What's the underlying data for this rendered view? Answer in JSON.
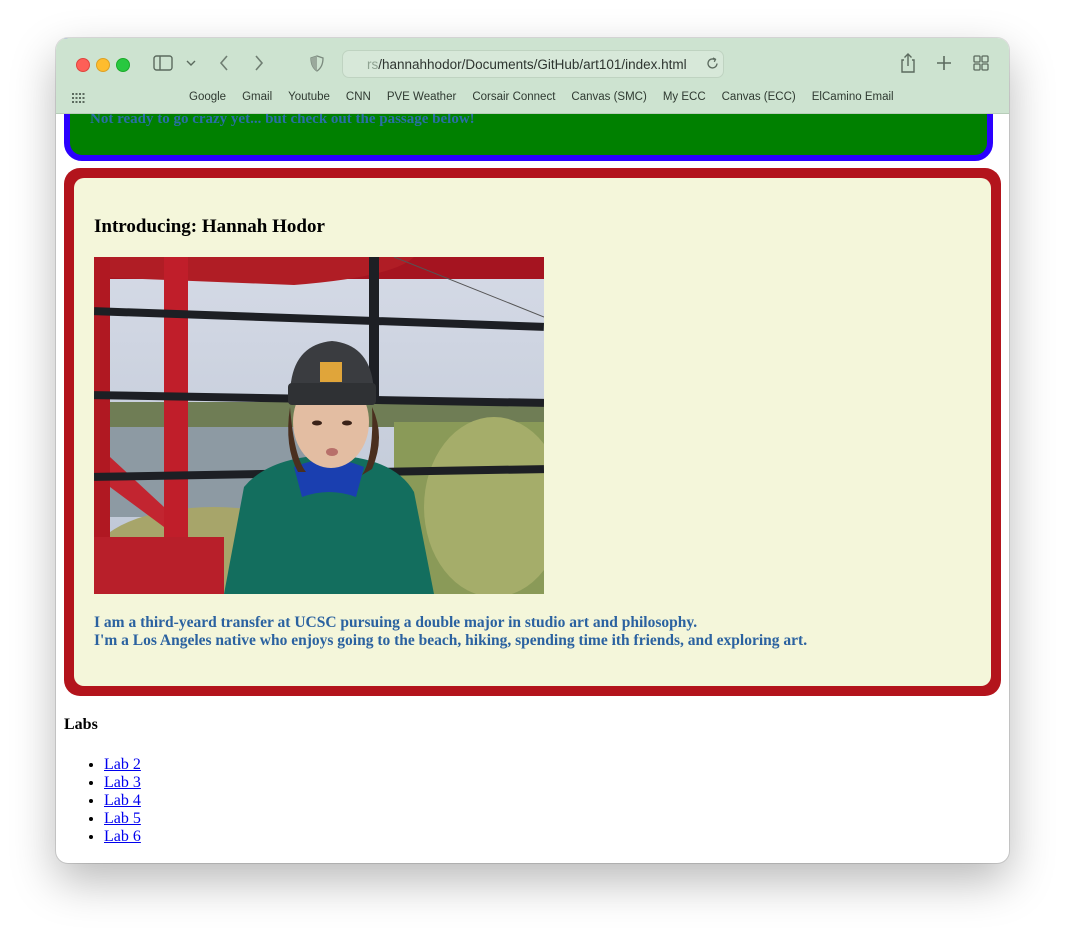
{
  "browser": {
    "url_prefix": "rs",
    "url_rest": "/hannahhodor/Documents/GitHub/art101/index.html",
    "bookmarks": [
      "Google",
      "Gmail",
      "Youtube",
      "CNN",
      "PVE Weather",
      "Corsair Connect",
      "Canvas (SMC)",
      "My ECC",
      "Canvas (ECC)",
      "ElCamino Email"
    ]
  },
  "green_section": {
    "text": "Not ready to go crazy yet... but check out the passage below!"
  },
  "intro": {
    "heading": "Introducing: Hannah Hodor",
    "bio_line1": "I am a third-yeard transfer at UCSC pursuing a double major in studio art and philosophy.",
    "bio_line2": "I'm a Los Angeles native who enjoys going to the beach, hiking, spending time ith friends, and exploring art."
  },
  "labs": {
    "heading": "Labs",
    "items": [
      "Lab 2",
      "Lab 3",
      "Lab 4",
      "Lab 5",
      "Lab 6"
    ]
  },
  "colors": {
    "outer_border": "#2a00ff",
    "green_bg": "#008000",
    "red_frame": "#b3141c",
    "inner_bg": "#f4f6da",
    "bio_text": "#2b62a0"
  }
}
